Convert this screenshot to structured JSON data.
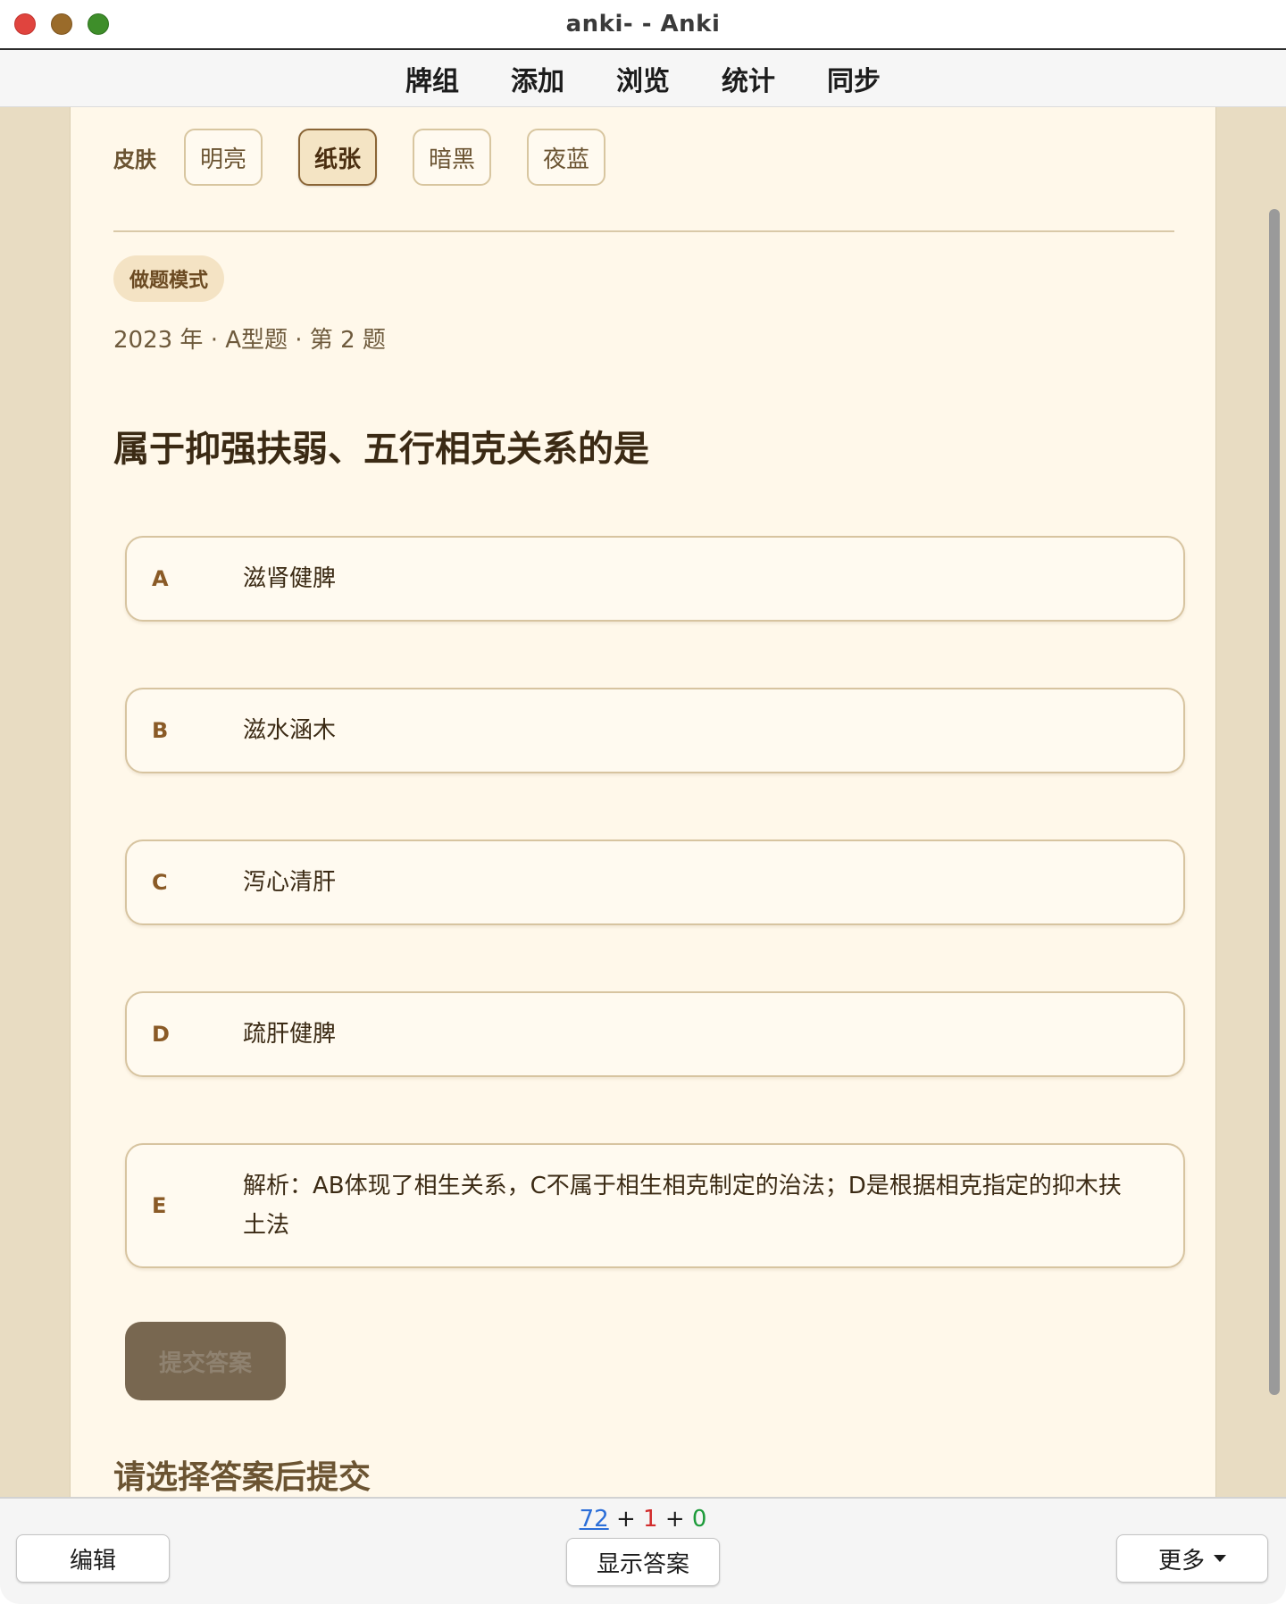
{
  "window": {
    "title": "anki- - Anki"
  },
  "nav": {
    "items": [
      "牌组",
      "添加",
      "浏览",
      "统计",
      "同步"
    ]
  },
  "skin": {
    "label": "皮肤",
    "options": [
      "明亮",
      "纸张",
      "暗黑",
      "夜蓝"
    ],
    "selected": "纸张"
  },
  "mode_badge": "做题模式",
  "meta": "2023 年 · A型题 · 第 2 题",
  "question": "属于抑强扶弱、五行相克关系的是",
  "options": [
    {
      "letter": "A",
      "text": "滋肾健脾"
    },
    {
      "letter": "B",
      "text": "滋水涵木"
    },
    {
      "letter": "C",
      "text": "泻心清肝"
    },
    {
      "letter": "D",
      "text": "疏肝健脾"
    },
    {
      "letter": "E",
      "text": "解析：AB体现了相生关系，C不属于相生相克制定的治法；D是根据相克指定的抑木扶土法"
    }
  ],
  "submit_label": "提交答案",
  "hint": "请选择答案后提交",
  "bottombar": {
    "counts": {
      "new": "72",
      "learn": "1",
      "review": "0",
      "plus": "+"
    },
    "edit_label": "编辑",
    "show_answer_label": "显示答案",
    "more_label": "更多"
  },
  "colors": {
    "card_bg": "#fff8ea",
    "page_bg": "#e8dcc2",
    "accent": "#8a6536",
    "submit_bg": "#786750",
    "count_new": "#2b6ed8",
    "count_learn": "#d12c2c",
    "count_review": "#1d9b3a"
  }
}
